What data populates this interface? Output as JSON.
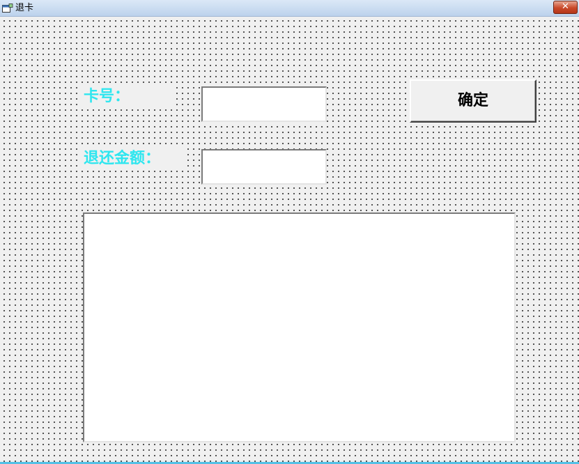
{
  "window": {
    "title": "退卡",
    "close_label": "✕"
  },
  "form": {
    "card_label": "卡号：",
    "refund_label": "退还金额：",
    "card_value": "",
    "refund_value": "",
    "output_text": "",
    "confirm_label": "确定"
  },
  "colors": {
    "label_text": "#2ee6ef",
    "form_background": "#f0f0f0",
    "close_button": "#c9492a"
  },
  "icons": {
    "app": "form-window-icon",
    "close": "close-icon"
  }
}
